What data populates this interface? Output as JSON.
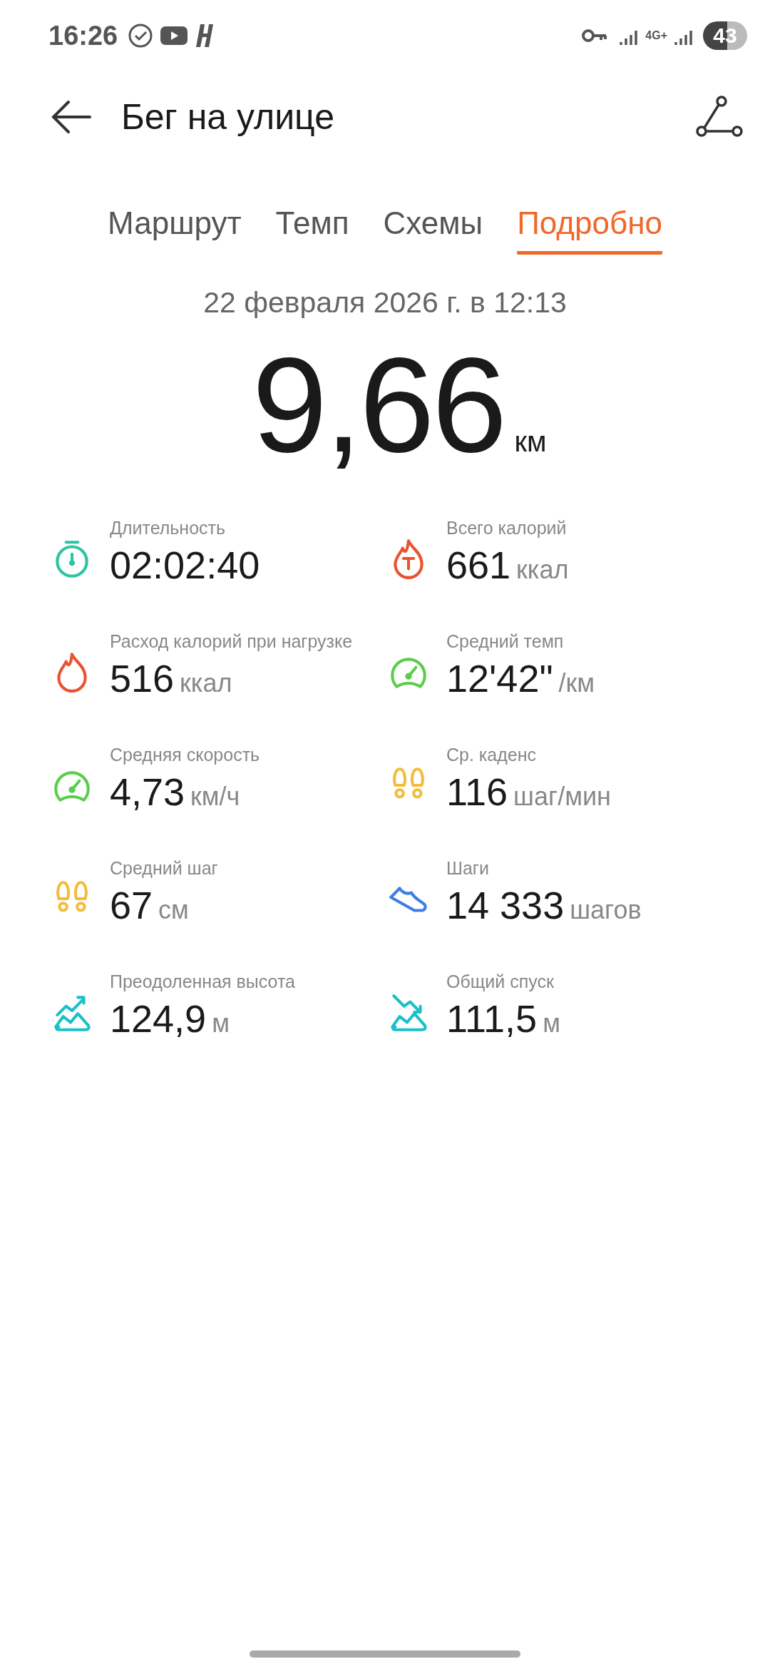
{
  "status_bar": {
    "time": "16:26",
    "network": "4G+",
    "battery": "43"
  },
  "header": {
    "title": "Бег на улице"
  },
  "tabs": [
    {
      "label": "Маршрут",
      "selected": false
    },
    {
      "label": "Темп",
      "selected": false
    },
    {
      "label": "Схемы",
      "selected": false
    },
    {
      "label": "Подробно",
      "selected": true
    }
  ],
  "date": "22 февраля 2026 г. в 12:13",
  "distance": {
    "value": "9,66",
    "unit": "км"
  },
  "stats": [
    {
      "kind": "stopwatch",
      "color": "#2ec4a0",
      "label": "Длительность",
      "value": "02:02:40"
    },
    {
      "kind": "flame-t",
      "color": "#ea5230",
      "label": "Всего калорий",
      "value": "661",
      "unit": "ккал"
    },
    {
      "kind": "flame",
      "color": "#ea5230",
      "label": "Расход калорий при нагрузке",
      "value": "516",
      "unit": "ккал"
    },
    {
      "kind": "gauge",
      "color": "#5acd4a",
      "label": "Средний темп",
      "value": "12'42\"",
      "unit": "/км"
    },
    {
      "kind": "gauge",
      "color": "#5acd4a",
      "label": "Средняя скорость",
      "value": "4,73",
      "unit": "км/ч"
    },
    {
      "kind": "footprints",
      "color": "#f4bc3c",
      "label": "Ср. каденс",
      "value": "116",
      "unit": "шаг/мин"
    },
    {
      "kind": "footprints",
      "color": "#f4bc3c",
      "label": "Средний шаг",
      "value": "67",
      "unit": "см"
    },
    {
      "kind": "shoe",
      "color": "#3d7fe6",
      "label": "Шаги",
      "value": "14 333",
      "unit": "шагов"
    },
    {
      "kind": "ascent",
      "color": "#1cc0c8",
      "label": "Преодоленная высота",
      "value": "124,9",
      "unit": "м"
    },
    {
      "kind": "descent",
      "color": "#1cc0c8",
      "label": "Общий спуск",
      "value": "111,5",
      "unit": "м"
    }
  ]
}
